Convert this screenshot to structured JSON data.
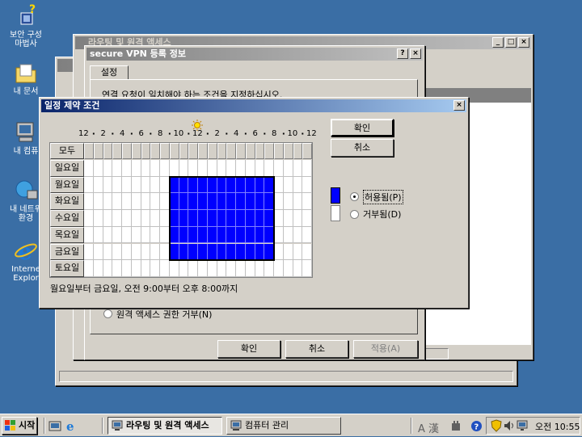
{
  "desktop": {
    "icons": [
      {
        "label_l1": "보안 구성",
        "label_l2": "마법사"
      },
      {
        "label_l1": "내 문서",
        "label_l2": ""
      },
      {
        "label_l1": "내 컴퓨",
        "label_l2": ""
      },
      {
        "label_l1": "내 네트워",
        "label_l2": "환경"
      },
      {
        "label_l1": "Interne",
        "label_l2": "Explor"
      }
    ]
  },
  "rras_window": {
    "title": "라우팅 및 원격 액세스"
  },
  "vpn_dialog": {
    "title": "secure VPN 등록 정보",
    "tab": "설정",
    "instruction": "연결 요청이 일치해야 하는 조건을 지정하십시오.",
    "deny_option": "원격 액세스 권한 거부(N)",
    "ok": "확인",
    "cancel": "취소",
    "apply": "적용(A)"
  },
  "schedule_dialog": {
    "title": "일정 제약 조건",
    "ok": "확인",
    "cancel": "취소",
    "all_label": "모두",
    "hour_labels": [
      "12",
      "2",
      "4",
      "6",
      "8",
      "10",
      "12",
      "2",
      "4",
      "6",
      "8",
      "10",
      "12"
    ],
    "days": [
      "일요일",
      "월요일",
      "화요일",
      "수요일",
      "목요일",
      "금요일",
      "토요일"
    ],
    "permitted_label": "허용됨(P)",
    "denied_label": "거부됨(D)",
    "selected_option": "permitted",
    "summary": "월요일부터 금요일, 오전 9:00부터 오후 8:00까지",
    "allowed_days_start": 1,
    "allowed_days_end": 5,
    "allowed_hour_start": 9,
    "allowed_hour_end": 20,
    "permitted_color": "#0000ff",
    "denied_color": "#ffffff"
  },
  "taskbar": {
    "start": "시작",
    "items": [
      "라우팅 및 원격 액세스",
      "컴퓨터 관리"
    ],
    "ime": "A 漢",
    "clock": "오전 10:55"
  }
}
